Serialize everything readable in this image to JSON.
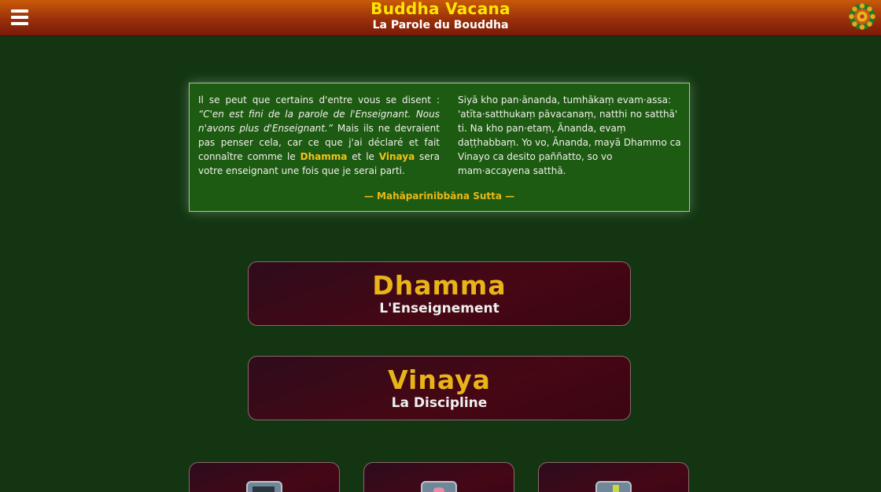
{
  "header": {
    "title": "Buddha Vacana",
    "subtitle": "La Parole du Bouddha",
    "menu_icon": "hamburger-menu-icon",
    "logo_icon": "dhamma-wheel-icon",
    "colors": {
      "title": "#ffe600",
      "bar_top": "#c85a08",
      "bar_bottom": "#7a1a08"
    }
  },
  "quote": {
    "french_part1": "Il se peut que certains d'entre vous se disent : ",
    "french_italic": "“C'en est fini de la parole de l'Enseignant. Nous n'avons plus d'Enseignant.”",
    "french_part2": " Mais ils ne devraient pas penser cela, car ce que j'ai déclaré et fait connaître comme le ",
    "french_dhamma": "Dhamma",
    "french_and": " et le ",
    "french_vinaya": "Vinaya",
    "french_part3": " sera votre enseignant une fois que je serai parti.",
    "pali": "Siyā kho pan·ānanda, tumhākaṃ evam·assa: 'atīta·satthukaṃ pāvacanaṃ, natthi no satthā' ti. Na kho pan·etaṃ, Ānanda, evaṃ daṭṭhabbaṃ. Yo vo, Ānanda, mayā Dhammo ca Vinayo ca desito paññatto, so vo mam·accayena satthā.",
    "source": "— Mahāparinibbāna Sutta —"
  },
  "buttons": {
    "dhamma": {
      "label": "Dhamma",
      "sublabel": "L'Enseignement"
    },
    "vinaya": {
      "label": "Vinaya",
      "sublabel": "La Discipline"
    }
  },
  "tiles": [
    {
      "icon": "book-icon"
    },
    {
      "icon": "lotus-icon"
    },
    {
      "icon": "candle-icon"
    }
  ],
  "colors": {
    "background": "#133512",
    "quote_bg": "#1d5a12",
    "accent_gold": "#e9b418",
    "button_bg": "#470714"
  }
}
